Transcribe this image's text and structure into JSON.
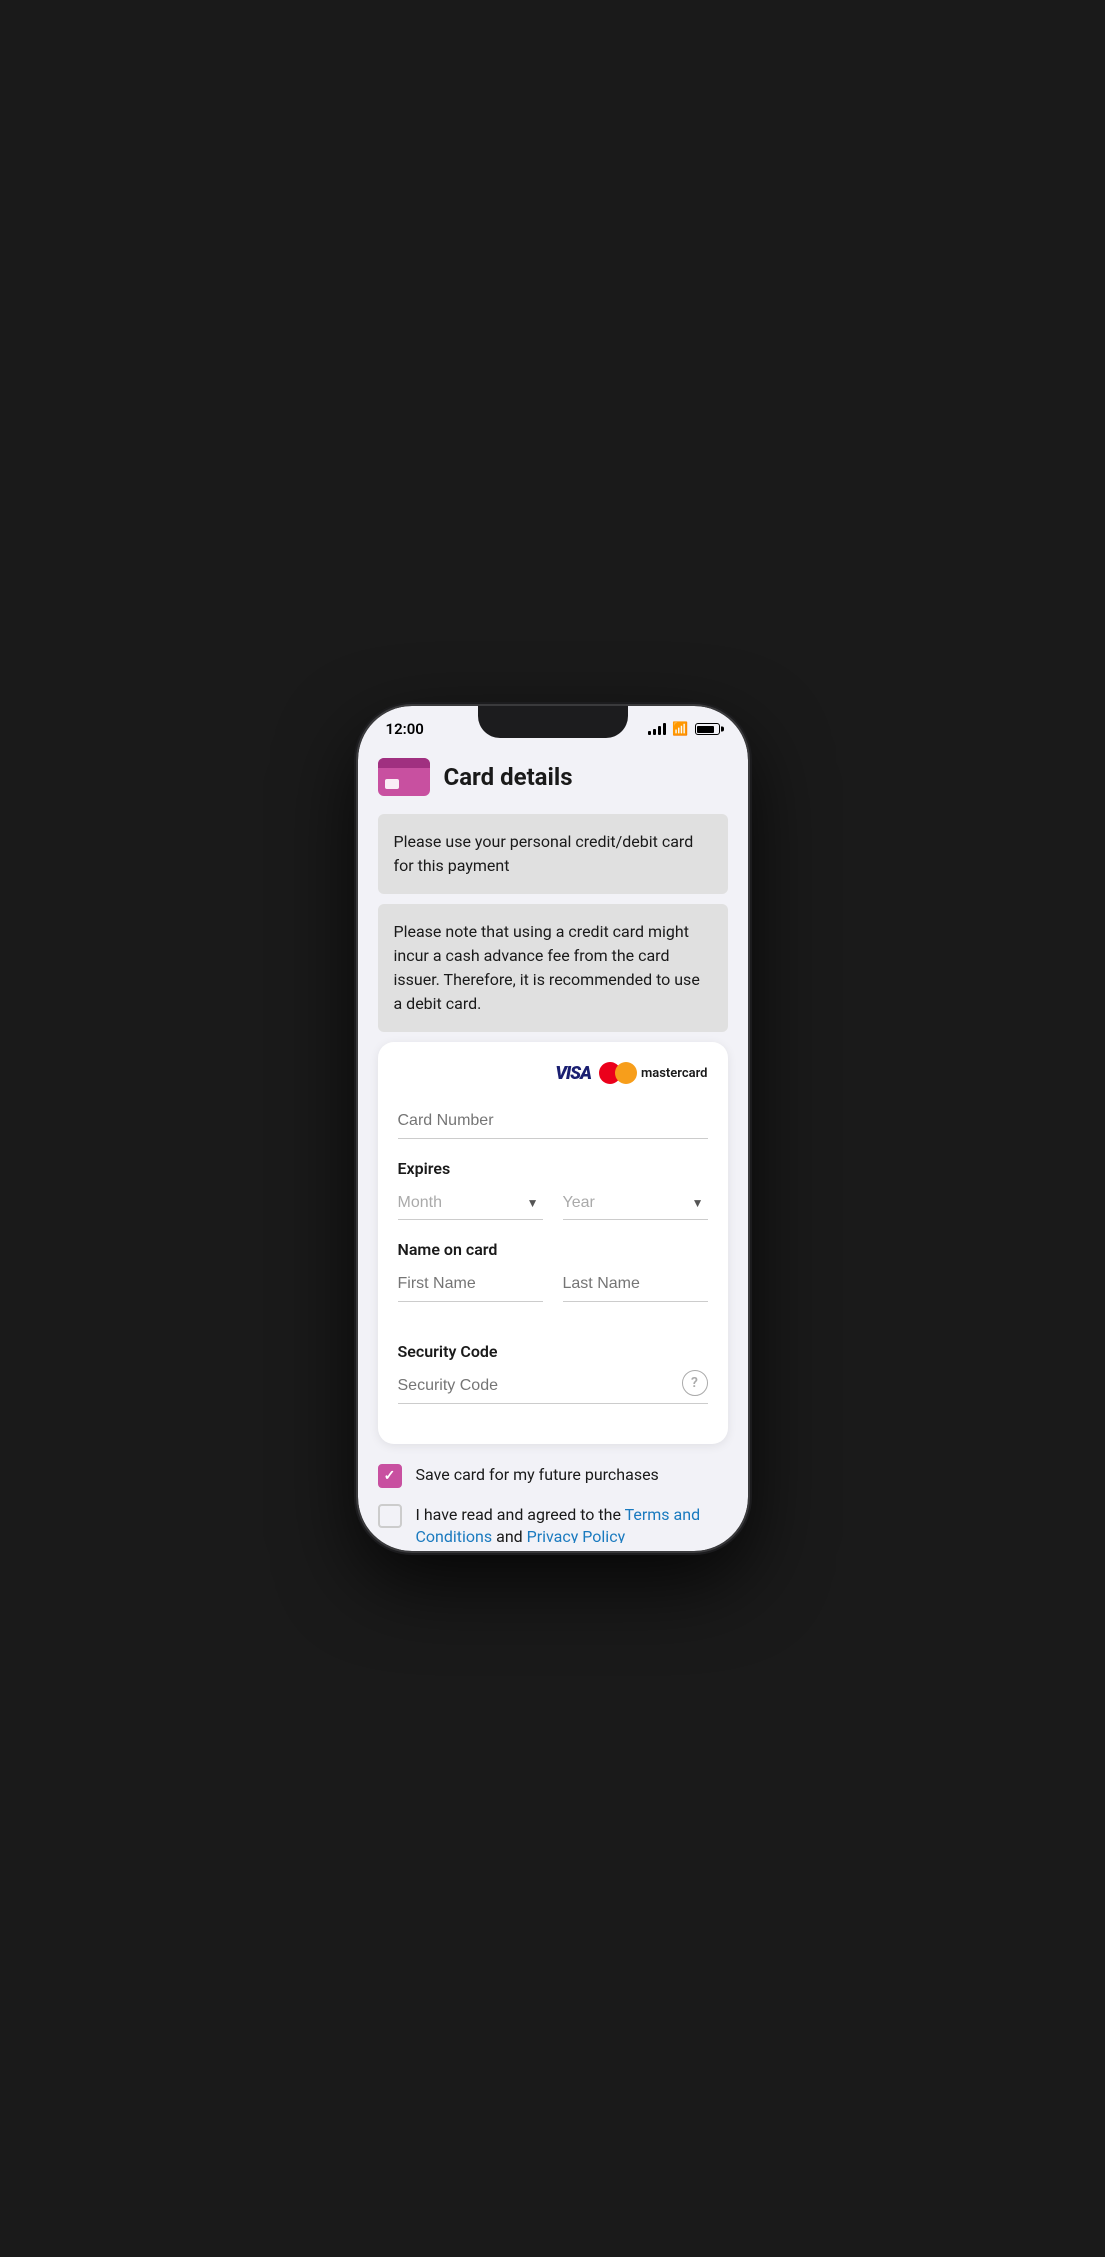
{
  "status_bar": {
    "time": "12:00",
    "signal": "4 bars",
    "wifi": "on",
    "battery": "full"
  },
  "page": {
    "title": "Card details",
    "icon_alt": "credit card icon"
  },
  "notices": [
    {
      "text": "Please use your personal credit/debit card for this payment"
    },
    {
      "text": "Please note that using a credit card might incur a cash advance fee from the card issuer. Therefore, it is recommended to use a debit card."
    }
  ],
  "card_form": {
    "card_number_placeholder": "Card Number",
    "expires_label": "Expires",
    "month_placeholder": "Month",
    "year_placeholder": "Year",
    "name_on_card_label": "Name on card",
    "first_name_placeholder": "First Name",
    "last_name_placeholder": "Last Name",
    "security_code_label": "Security Code",
    "security_code_placeholder": "Security Code",
    "help_icon": "?"
  },
  "checkboxes": [
    {
      "id": "save-card",
      "label": "Save card for my future purchases",
      "checked": true
    },
    {
      "id": "terms",
      "label": "I have read and agreed to the ",
      "checked": false,
      "link1_text": "Terms and Conditions",
      "link2_text": "Privacy Policy",
      "link3_text": "and"
    }
  ],
  "card_brands": {
    "visa": "VISA",
    "mastercard": "mastercard"
  }
}
